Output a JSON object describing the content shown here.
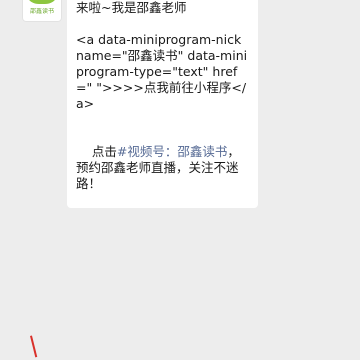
{
  "avatar": {
    "label": "邵鑫读书"
  },
  "message": {
    "line_intro": "来啦~我是邵鑫老师",
    "code_block": "<a data-miniprogram-nickname=\"邵鑫读书\" data-miniprogram-type=\"text\" href=\" \">>>>点我前往小程序</a>",
    "cta_prefix": "点击",
    "cta_link": "#视频号：邵鑫读书",
    "cta_suffix": "，预约邵鑫老师直播，关注不迷路！"
  },
  "colors": {
    "background": "#ededed",
    "bubble": "#ffffff",
    "link": "#576b95",
    "accent_mark": "#d9302a"
  }
}
